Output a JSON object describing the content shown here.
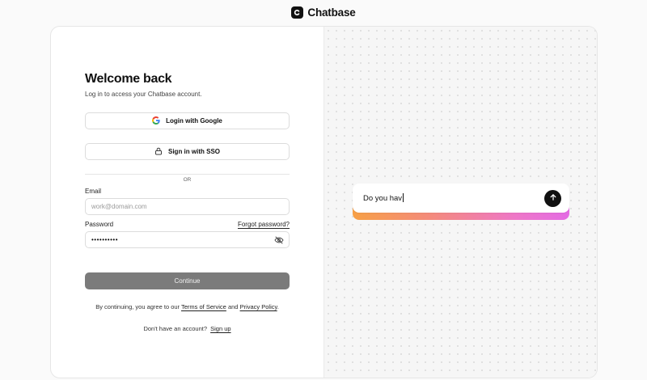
{
  "brand": {
    "name": "Chatbase",
    "icon": "chatbase-logo-icon"
  },
  "login": {
    "title": "Welcome back",
    "subtitle": "Log in to access your Chatbase account.",
    "google_label": "Login with Google",
    "sso_label": "Sign in with SSO",
    "divider": "OR",
    "email_label": "Email",
    "email_placeholder": "work@domain.com",
    "email_value": "",
    "password_label": "Password",
    "forgot_label": "Forgot password?",
    "password_value": "••••••••••",
    "password_toggle_icon": "eye-off-icon",
    "continue_label": "Continue",
    "terms_prefix": "By continuing, you agree to our",
    "terms_link": "Terms of Service",
    "terms_and": "and",
    "privacy_link": "Privacy Policy",
    "terms_suffix": ".",
    "signup_prefix": "Don't have an account?",
    "signup_link": "Sign up"
  },
  "chat": {
    "input_text": "Do you hav",
    "send_icon": "arrow-up-icon"
  },
  "colors": {
    "continue_bg": "#7b7b7b",
    "gradient": [
      "#f7a046",
      "#f48b7a",
      "#ee77c7",
      "#e46ce4"
    ]
  }
}
